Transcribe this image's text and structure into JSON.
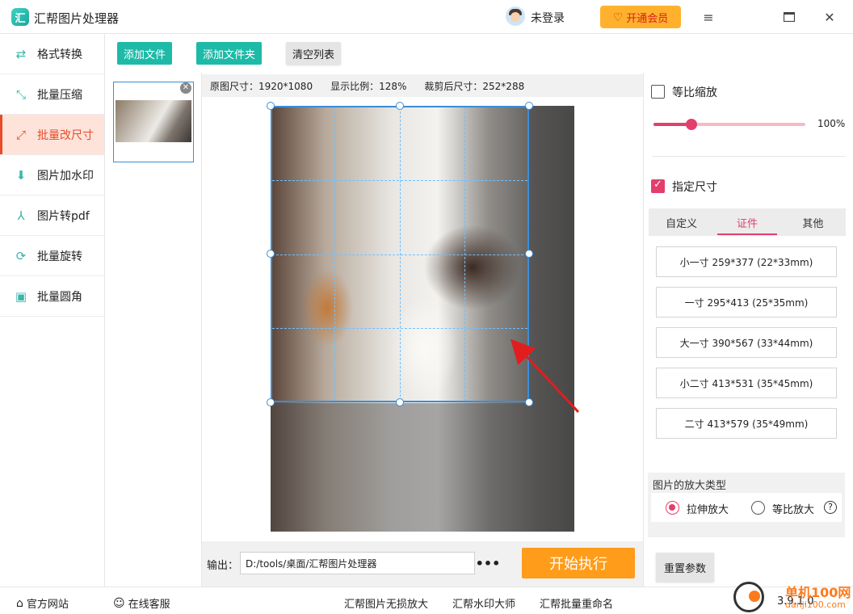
{
  "app": {
    "title": "汇帮图片处理器",
    "logo_glyph": "汇"
  },
  "header": {
    "user_label": "未登录",
    "vip_label": "开通会员",
    "accent": "#ffb12d"
  },
  "sidebar": {
    "items": [
      {
        "label": "格式转换",
        "icon": "format-convert-icon",
        "glyph": "⇄"
      },
      {
        "label": "批量压缩",
        "icon": "compress-icon",
        "glyph": "⤡"
      },
      {
        "label": "批量改尺寸",
        "icon": "resize-icon",
        "glyph": "⤢"
      },
      {
        "label": "图片加水印",
        "icon": "watermark-icon",
        "glyph": "⬇"
      },
      {
        "label": "图片转pdf",
        "icon": "pdf-icon",
        "glyph": "⅄"
      },
      {
        "label": "批量旋转",
        "icon": "rotate-icon",
        "glyph": "⟳"
      },
      {
        "label": "批量圆角",
        "icon": "image-corner-icon",
        "glyph": "▣"
      }
    ],
    "active_index": 2
  },
  "toolbar": {
    "add_file": "添加文件",
    "add_folder": "添加文件夹",
    "clear_list": "清空列表"
  },
  "info": {
    "original_size": "原图尺寸：1920*1080",
    "display_ratio": "显示比例：128%",
    "cropped_size": "裁剪后尺寸：252*288"
  },
  "output": {
    "label": "输出：",
    "path": "D:/tools/桌面/汇帮图片处理器",
    "more": "•••",
    "start": "开始执行"
  },
  "right": {
    "proportional_label": "等比缩放",
    "proportional_checked": false,
    "scale_percent": 100,
    "scale_label": "100%",
    "specify_label": "指定尺寸",
    "specify_checked": true,
    "tabs": [
      "自定义",
      "证件",
      "其他"
    ],
    "active_tab": 1,
    "sizes": [
      "小一寸  259*377  (22*33mm)",
      "一寸  295*413  (25*35mm)",
      "大一寸  390*567  (33*44mm)",
      "小二寸  413*531  (35*45mm)",
      "二寸  413*579  (35*49mm)"
    ],
    "enlarge_title": "图片的放大类型",
    "enlarge_stretch": "拉伸放大",
    "enlarge_proportional": "等比放大",
    "enlarge_selected": "stretch",
    "reset": "重置参数",
    "accent": "#e23f6d"
  },
  "footer": {
    "website": "官方网站",
    "service": "在线客服",
    "link1": "汇帮图片无损放大",
    "link2": "汇帮水印大师",
    "link3": "汇帮批量重命名",
    "version": "3.9.1.0"
  },
  "watermark": {
    "line1": "单机100网",
    "line2": "danji100.com"
  }
}
